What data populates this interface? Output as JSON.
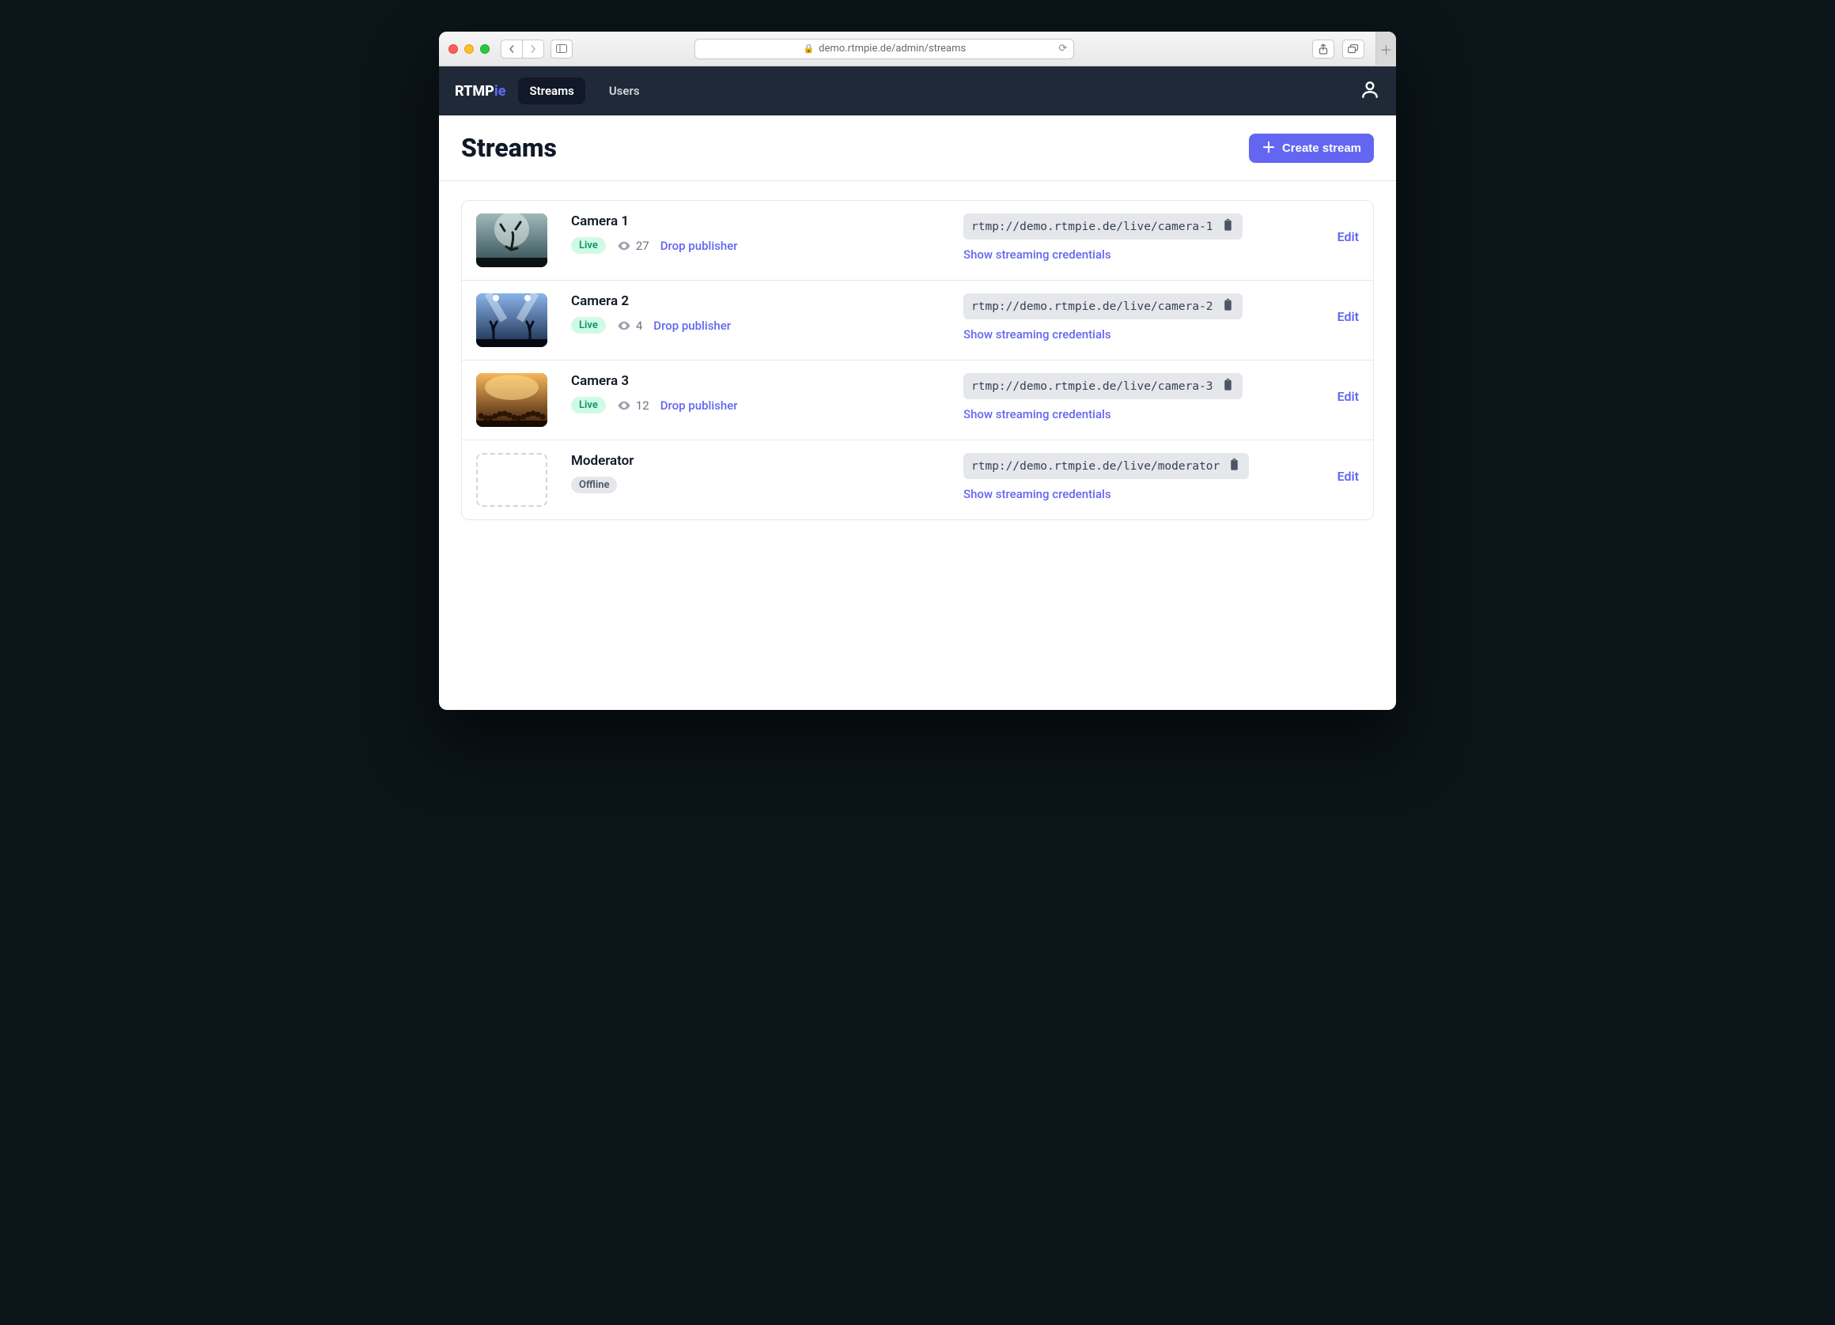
{
  "browser": {
    "url": "demo.rtmpie.de/admin/streams"
  },
  "header": {
    "logo_prefix": "RTMP",
    "logo_suffix": "ie",
    "nav": {
      "streams": "Streams",
      "users": "Users"
    }
  },
  "page": {
    "title": "Streams",
    "create_label": "Create stream"
  },
  "labels": {
    "drop_publisher": "Drop publisher",
    "show_creds": "Show streaming credentials",
    "edit": "Edit",
    "live": "Live",
    "offline": "Offline"
  },
  "streams": [
    {
      "name": "Camera 1",
      "status": "live",
      "viewers": "27",
      "url": "rtmp://demo.rtmpie.de/live/camera-1",
      "thumb": "concert1"
    },
    {
      "name": "Camera 2",
      "status": "live",
      "viewers": "4",
      "url": "rtmp://demo.rtmpie.de/live/camera-2",
      "thumb": "concert2"
    },
    {
      "name": "Camera 3",
      "status": "live",
      "viewers": "12",
      "url": "rtmp://demo.rtmpie.de/live/camera-3",
      "thumb": "concert3"
    },
    {
      "name": "Moderator",
      "status": "offline",
      "viewers": null,
      "url": "rtmp://demo.rtmpie.de/live/moderator",
      "thumb": null
    }
  ]
}
